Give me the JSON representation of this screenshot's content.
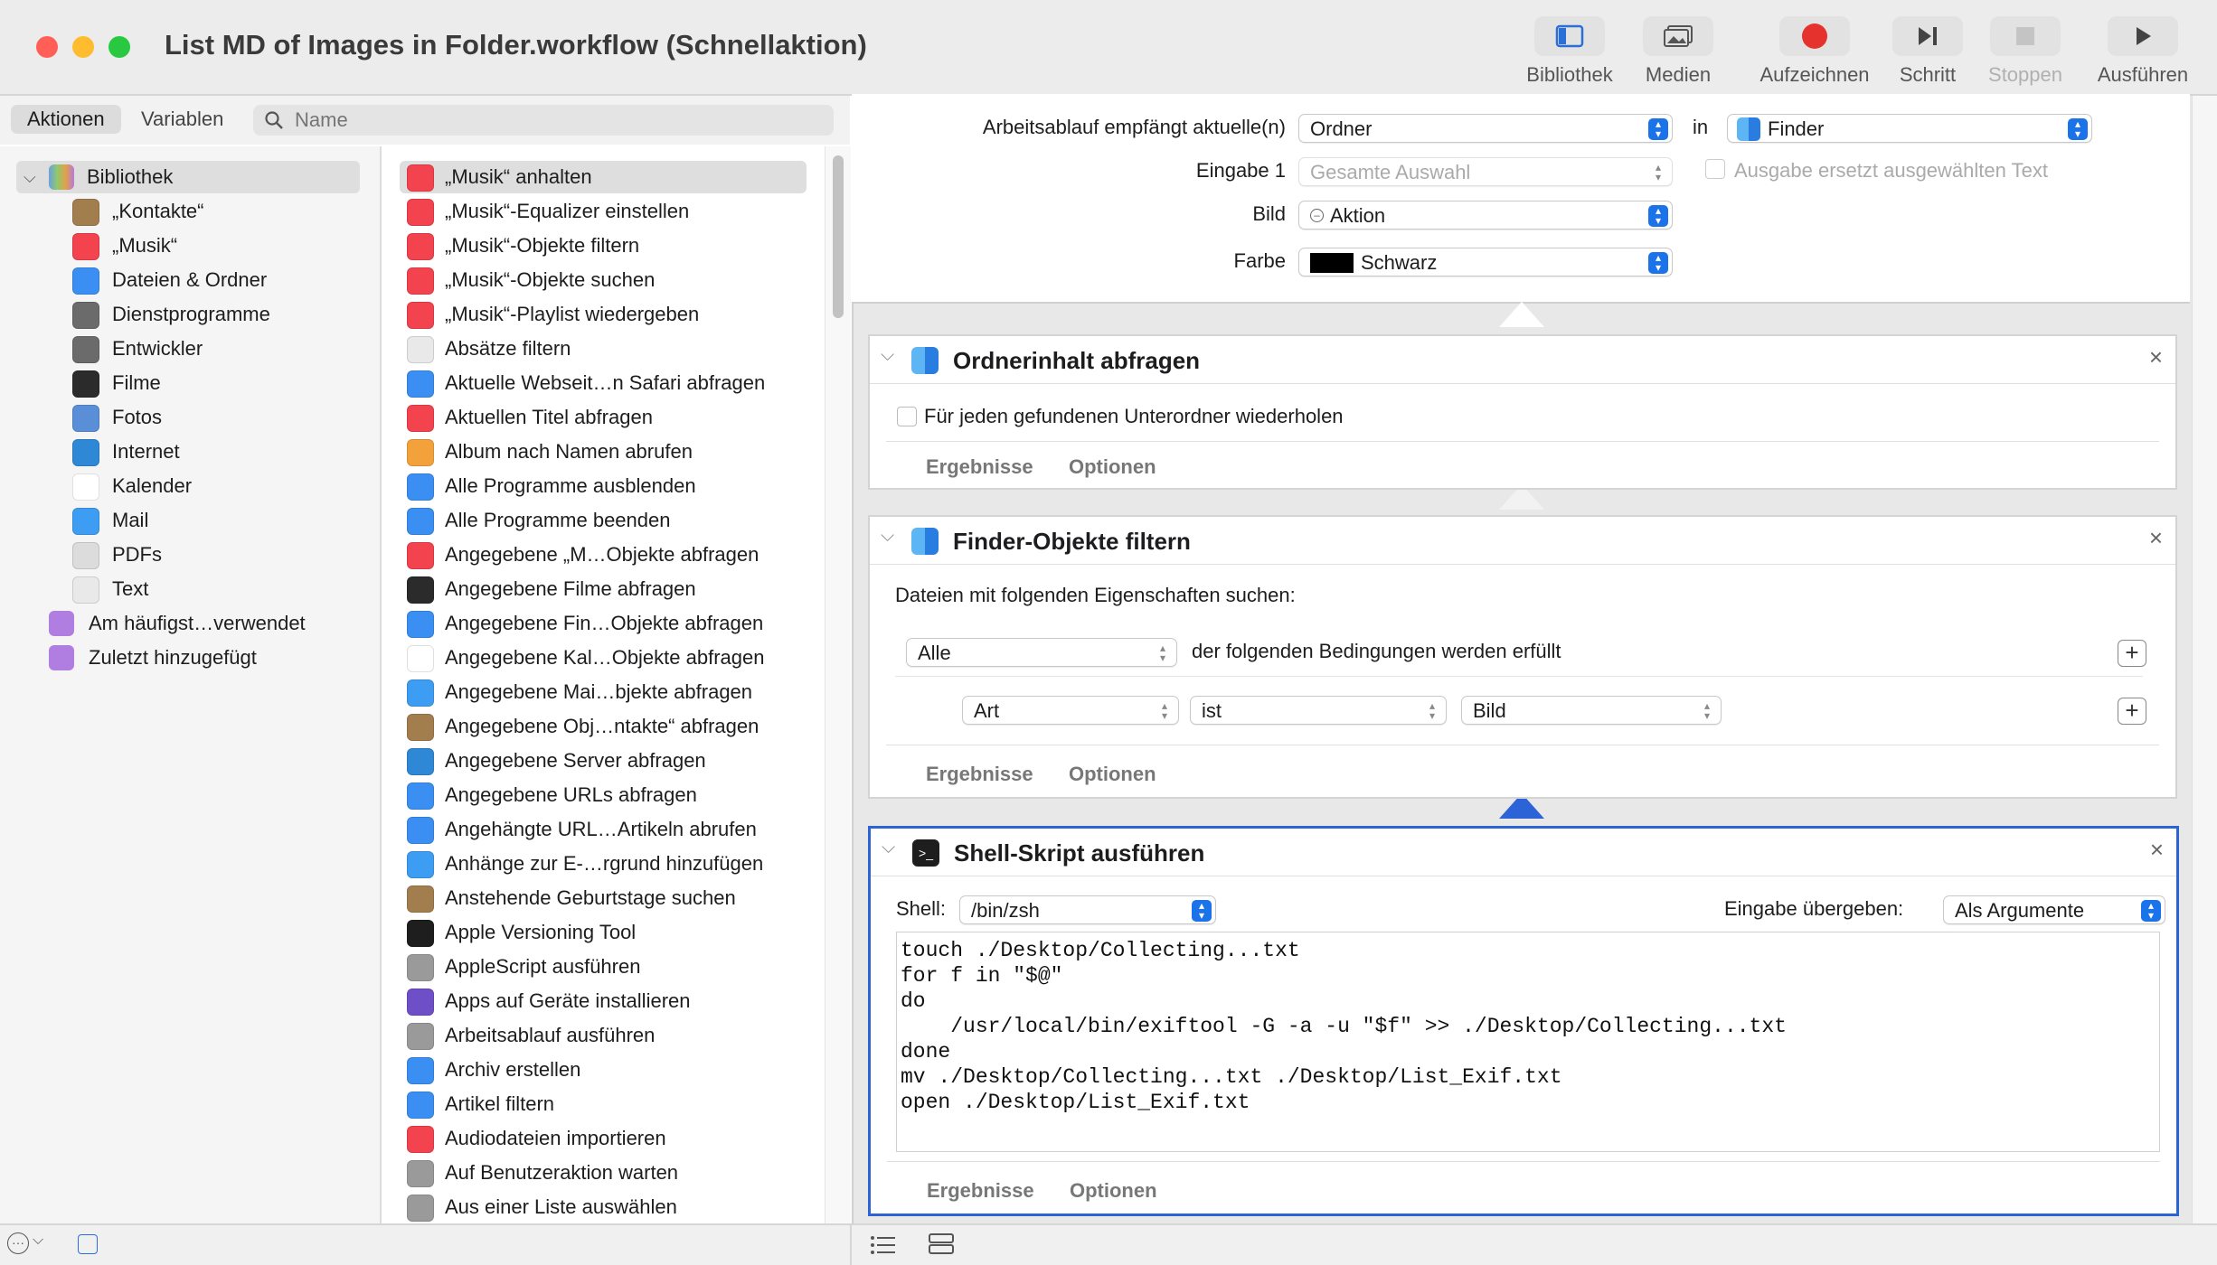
{
  "window": {
    "title": "List MD of Images in Folder.workflow (Schnellaktion)"
  },
  "toolbar": {
    "library": "Bibliothek",
    "media": "Medien",
    "record": "Aufzeichnen",
    "step": "Schritt",
    "stop": "Stoppen",
    "run": "Ausführen"
  },
  "sidebar": {
    "tab_actions": "Aktionen",
    "tab_variables": "Variablen",
    "search_placeholder": "Name",
    "library_root": "Bibliothek",
    "items": [
      {
        "label": "„Kontakte“",
        "icon": "contacts-icon",
        "color": "#a27e4f"
      },
      {
        "label": "„Musik“",
        "icon": "music-icon",
        "color": "#f2434f"
      },
      {
        "label": "Dateien & Ordner",
        "icon": "finder-icon",
        "color": "#3b8ff3"
      },
      {
        "label": "Dienstprogramme",
        "icon": "tools-icon",
        "color": "#6b6b6b"
      },
      {
        "label": "Entwickler",
        "icon": "developer-icon",
        "color": "#6b6b6b"
      },
      {
        "label": "Filme",
        "icon": "quicktime-icon",
        "color": "#2b2b2b"
      },
      {
        "label": "Fotos",
        "icon": "photos-icon",
        "color": "#5a8fd8"
      },
      {
        "label": "Internet",
        "icon": "globe-icon",
        "color": "#2f88d6"
      },
      {
        "label": "Kalender",
        "icon": "calendar-icon",
        "color": "#ffffff"
      },
      {
        "label": "Mail",
        "icon": "mail-icon",
        "color": "#3d9df3"
      },
      {
        "label": "PDFs",
        "icon": "pdf-icon",
        "color": "#dcdcdc"
      },
      {
        "label": "Text",
        "icon": "text-icon",
        "color": "#e9e9e9"
      }
    ],
    "smart_groups": [
      {
        "label": "Am häufigst…verwendet",
        "icon": "smart-folder-icon"
      },
      {
        "label": "Zuletzt hinzugefügt",
        "icon": "smart-folder-icon"
      }
    ]
  },
  "actions": [
    {
      "label": "„Musik“ anhalten",
      "icon": "music-icon",
      "color": "#f2434f"
    },
    {
      "label": "„Musik“-Equalizer einstellen",
      "icon": "music-icon",
      "color": "#f2434f"
    },
    {
      "label": "„Musik“-Objekte filtern",
      "icon": "music-icon",
      "color": "#f2434f"
    },
    {
      "label": "„Musik“-Objekte suchen",
      "icon": "music-icon",
      "color": "#f2434f"
    },
    {
      "label": "„Musik“-Playlist wiedergeben",
      "icon": "music-icon",
      "color": "#f2434f"
    },
    {
      "label": "Absätze filtern",
      "icon": "text-icon",
      "color": "#e9e9e9"
    },
    {
      "label": "Aktuelle Webseit…n Safari abfragen",
      "icon": "safari-icon",
      "color": "#3b8ff3"
    },
    {
      "label": "Aktuellen Titel abfragen",
      "icon": "music-icon",
      "color": "#f2434f"
    },
    {
      "label": "Album nach Namen abrufen",
      "icon": "photos-icon",
      "color": "#f3a23b"
    },
    {
      "label": "Alle Programme ausblenden",
      "icon": "finder-icon",
      "color": "#3b8ff3"
    },
    {
      "label": "Alle Programme beenden",
      "icon": "finder-icon",
      "color": "#3b8ff3"
    },
    {
      "label": "Angegebene „M…Objekte abfragen",
      "icon": "music-icon",
      "color": "#f2434f"
    },
    {
      "label": "Angegebene Filme abfragen",
      "icon": "quicktime-icon",
      "color": "#2b2b2b"
    },
    {
      "label": "Angegebene Fin…Objekte abfragen",
      "icon": "finder-icon",
      "color": "#3b8ff3"
    },
    {
      "label": "Angegebene Kal…Objekte abfragen",
      "icon": "calendar-icon",
      "color": "#ffffff"
    },
    {
      "label": "Angegebene Mai…bjekte abfragen",
      "icon": "mail-icon",
      "color": "#3d9df3"
    },
    {
      "label": "Angegebene Obj…ntakte“ abfragen",
      "icon": "contacts-icon",
      "color": "#a27e4f"
    },
    {
      "label": "Angegebene Server abfragen",
      "icon": "globe-icon",
      "color": "#2f88d6"
    },
    {
      "label": "Angegebene URLs abfragen",
      "icon": "safari-icon",
      "color": "#3b8ff3"
    },
    {
      "label": "Angehängte URL…Artikeln abrufen",
      "icon": "safari-icon",
      "color": "#3b8ff3"
    },
    {
      "label": "Anhänge zur E-…rgrund hinzufügen",
      "icon": "mail-icon",
      "color": "#3d9df3"
    },
    {
      "label": "Anstehende Geburtstage suchen",
      "icon": "contacts-icon",
      "color": "#a27e4f"
    },
    {
      "label": "Apple Versioning Tool",
      "icon": "terminal-icon",
      "color": "#1e1e1e"
    },
    {
      "label": "AppleScript ausführen",
      "icon": "script-icon",
      "color": "#9a9a9a"
    },
    {
      "label": "Apps auf Geräte installieren",
      "icon": "configurator-icon",
      "color": "#6e4fc7"
    },
    {
      "label": "Arbeitsablauf ausführen",
      "icon": "automator-icon",
      "color": "#9a9a9a"
    },
    {
      "label": "Archiv erstellen",
      "icon": "finder-icon",
      "color": "#3b8ff3"
    },
    {
      "label": "Artikel filtern",
      "icon": "safari-icon",
      "color": "#3b8ff3"
    },
    {
      "label": "Audiodateien importieren",
      "icon": "music-icon",
      "color": "#f2434f"
    },
    {
      "label": "Auf Benutzeraktion warten",
      "icon": "automator-icon",
      "color": "#9a9a9a"
    },
    {
      "label": "Aus einer Liste auswählen",
      "icon": "automator-icon",
      "color": "#9a9a9a"
    }
  ],
  "workflow_header": {
    "receives_label": "Arbeitsablauf empfängt aktuelle(n)",
    "receives_value": "Ordner",
    "in_label": "in",
    "in_value": "Finder",
    "input_label": "Eingabe 1",
    "input_value": "Gesamte Auswahl",
    "replaces_label": "Ausgabe ersetzt ausgewählten Text",
    "image_label": "Bild",
    "image_value": "Aktion",
    "color_label": "Farbe",
    "color_value": "Schwarz",
    "color_swatch": "#000000"
  },
  "action1": {
    "title": "Ordnerinhalt abfragen",
    "checkbox_label": "Für jeden gefundenen Unterordner wiederholen",
    "results": "Ergebnisse",
    "options": "Optionen"
  },
  "action2": {
    "title": "Finder-Objekte filtern",
    "subtitle": "Dateien mit folgenden Eigenschaften suchen:",
    "match_value": "Alle",
    "match_text": "der folgenden Bedingungen werden erfüllt",
    "cond_field": "Art",
    "cond_op": "ist",
    "cond_value": "Bild",
    "results": "Ergebnisse",
    "options": "Optionen"
  },
  "action3": {
    "title": "Shell-Skript ausführen",
    "shell_label": "Shell:",
    "shell_value": "/bin/zsh",
    "pass_label": "Eingabe übergeben:",
    "pass_value": "Als Argumente",
    "script": "touch ./Desktop/Collecting...txt\nfor f in \"$@\"\ndo\n    /usr/local/bin/exiftool -G -a -u \"$f\" >> ./Desktop/Collecting...txt\ndone\nmv ./Desktop/Collecting...txt ./Desktop/List_Exif.txt\nopen ./Desktop/List_Exif.txt",
    "results": "Ergebnisse",
    "options": "Optionen"
  },
  "colors": {
    "accent": "#1a73e8",
    "record": "#e5322d",
    "selected_border": "#2c64d8"
  }
}
